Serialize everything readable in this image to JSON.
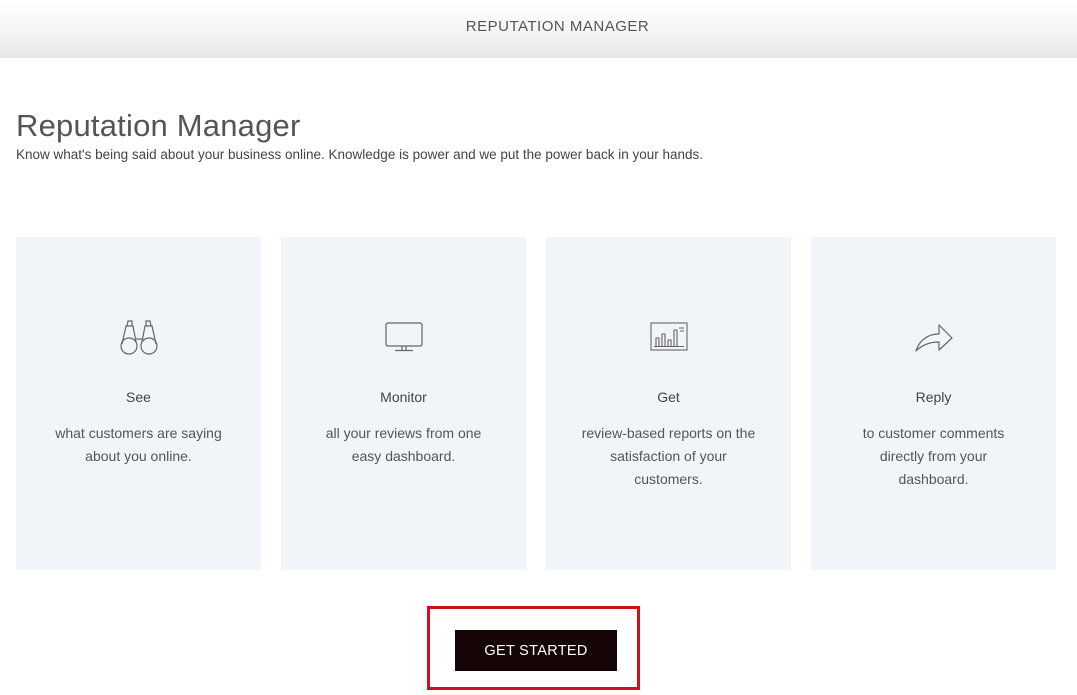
{
  "header": {
    "title": "REPUTATION MANAGER"
  },
  "main": {
    "title": "Reputation Manager",
    "subtitle": "Know what's being said about your business online. Knowledge is power and we put the power back in your hands."
  },
  "cards": [
    {
      "icon": "binoculars-icon",
      "heading": "See",
      "text": "what customers are saying about you online."
    },
    {
      "icon": "monitor-icon",
      "heading": "Monitor",
      "text": "all your reviews from one easy dashboard."
    },
    {
      "icon": "bar-chart-report-icon",
      "heading": "Get",
      "text": "review-based reports on the satisfaction of your customers."
    },
    {
      "icon": "reply-arrow-icon",
      "heading": "Reply",
      "text": "to customer comments directly from your dashboard."
    }
  ],
  "cta": {
    "label": "GET STARTED"
  },
  "colors": {
    "card_background": "#f1f4f9",
    "button_background": "#150506",
    "highlight_border": "#d0101b"
  }
}
